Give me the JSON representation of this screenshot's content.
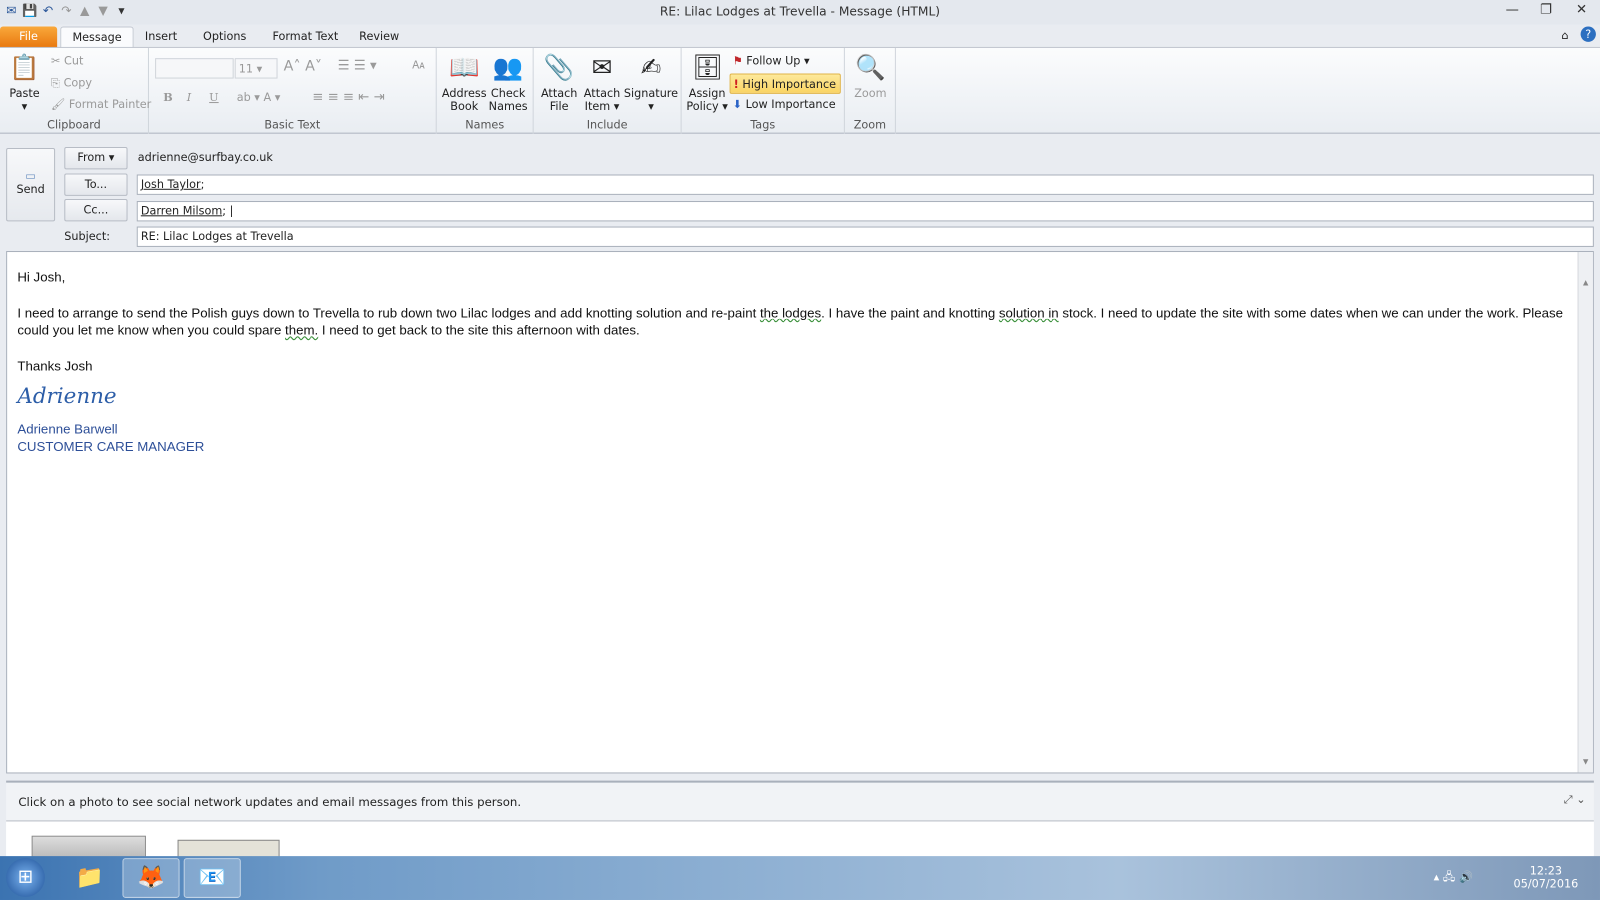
{
  "window": {
    "title": "RE: Lilac Lodges at Trevella  -  Message (HTML)"
  },
  "tabs": [
    {
      "label": "File"
    },
    {
      "label": "Message"
    },
    {
      "label": "Insert"
    },
    {
      "label": "Options"
    },
    {
      "label": "Format Text"
    },
    {
      "label": "Review"
    }
  ],
  "ribbon": {
    "clipboard": {
      "label": "Clipboard",
      "paste": "Paste",
      "cut": "Cut",
      "copy": "Copy",
      "format_painter": "Format Painter"
    },
    "basic_text": {
      "label": "Basic Text",
      "font_size": "11",
      "bold": "B",
      "italic": "I",
      "underline": "U"
    },
    "names": {
      "label": "Names",
      "address_book_1": "Address",
      "address_book_2": "Book",
      "check_names_1": "Check",
      "check_names_2": "Names"
    },
    "include": {
      "label": "Include",
      "attach_file_1": "Attach",
      "attach_file_2": "File",
      "attach_item_1": "Attach",
      "attach_item_2": "Item ▾",
      "signature": "Signature"
    },
    "tags": {
      "label": "Tags",
      "assign_policy_1": "Assign",
      "assign_policy_2": "Policy ▾",
      "follow_up": "Follow Up ▾",
      "high_importance": "High Importance",
      "low_importance": "Low Importance"
    },
    "zoom": {
      "label": "Zoom",
      "zoom": "Zoom"
    }
  },
  "header": {
    "send": "Send",
    "from_button": "From ▾",
    "from_value": "adrienne@surfbay.co.uk",
    "to_button": "To...",
    "to_value": "Josh Taylor",
    "cc_button": "Cc...",
    "cc_value": "Darren Milsom",
    "subject_label": "Subject:",
    "subject_value": "RE: Lilac Lodges at Trevella"
  },
  "body": {
    "greeting": "Hi Josh,",
    "p1a": "I need to arrange to send the Polish guys down to Trevella to rub down two Lilac lodges and add knotting solution and re-paint ",
    "p1b": "the  lodges",
    "p1c": ".   I have the paint and knotting ",
    "p1d": "solution  in",
    "p1e": " stock.     I need to update the site with some dates when we can under the work.  Please could you let me know when you could spare ",
    "p1f": "them.",
    "p1g": "  I need to get back to the site this afternoon with dates.",
    "thanks": "Thanks Josh",
    "signature_script": "Adrienne",
    "sig_name": "Adrienne Barwell",
    "sig_title": "CUSTOMER CARE MANAGER"
  },
  "people_pane": {
    "message": "Click on a photo to see social network updates and email messages from this person."
  },
  "taskbar": {
    "time": "12:23",
    "date": "05/07/2016"
  }
}
